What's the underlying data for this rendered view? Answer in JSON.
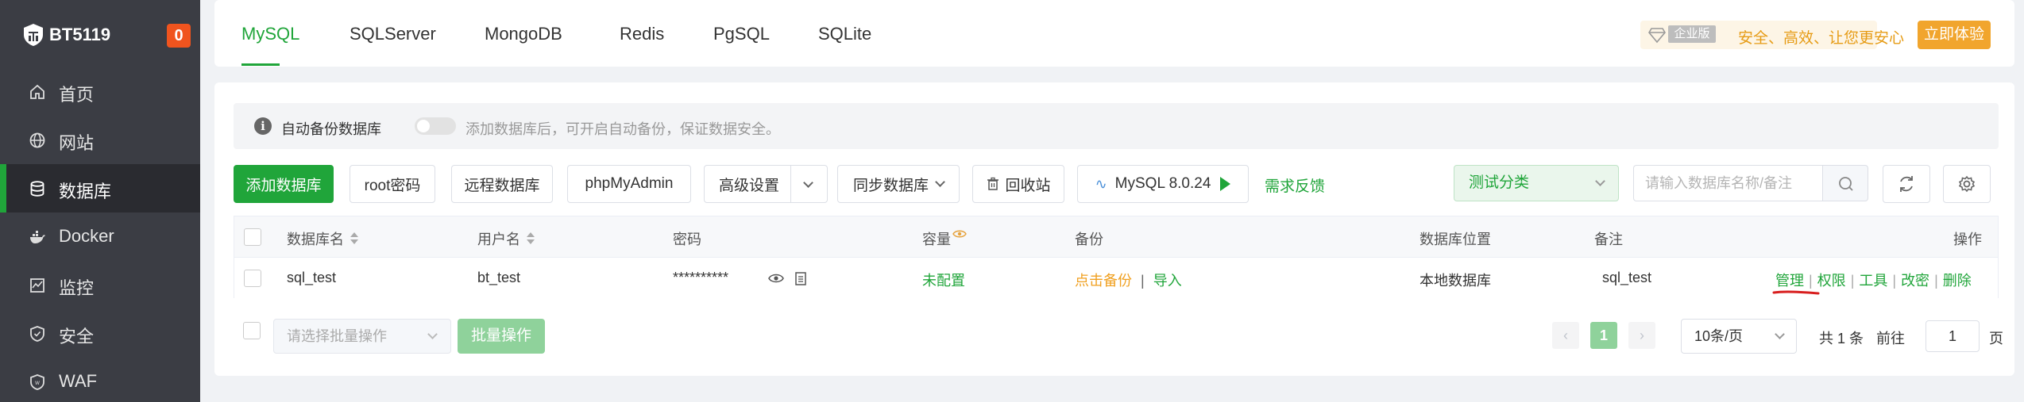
{
  "sidebar": {
    "brand": {
      "name": "BT5119",
      "badge": "0"
    },
    "items": [
      {
        "label": "首页",
        "icon": "home-icon"
      },
      {
        "label": "网站",
        "icon": "globe-icon"
      },
      {
        "label": "数据库",
        "icon": "database-icon",
        "active": true
      },
      {
        "label": "Docker",
        "icon": "docker-icon"
      },
      {
        "label": "监控",
        "icon": "monitor-icon"
      },
      {
        "label": "安全",
        "icon": "shield-icon"
      },
      {
        "label": "WAF",
        "icon": "waf-shield-icon"
      }
    ]
  },
  "tabs": {
    "items": [
      "MySQL",
      "SQLServer",
      "MongoDB",
      "Redis",
      "PgSQL",
      "SQLite"
    ],
    "active": "MySQL"
  },
  "enterprise": {
    "tag": "企业版",
    "slogan": "安全、高效、让您更安心",
    "try_label": "立即体验",
    "accent": "#f1a52d"
  },
  "notice": {
    "label": "自动备份数据库",
    "hint": "添加数据库后，可开启自动备份，保证数据安全。",
    "toggle_on": false
  },
  "toolbar": {
    "add_db": "添加数据库",
    "root_pwd": "root密码",
    "remote_db": "远程数据库",
    "phpmyadmin": "phpMyAdmin",
    "advanced": "高级设置",
    "sync": "同步数据库",
    "recycle": "回收站",
    "mysql_version": "MySQL 8.0.24",
    "feedback": "需求反馈",
    "category": "测试分类",
    "search_placeholder": "请输入数据库名称/备注"
  },
  "table": {
    "headers": {
      "name": "数据库名",
      "user": "用户名",
      "password": "密码",
      "capacity": "容量",
      "backup": "备份",
      "location": "数据库位置",
      "remark": "备注",
      "actions": "操作"
    },
    "rows": [
      {
        "name": "sql_test",
        "user": "bt_test",
        "password": "**********",
        "capacity": "未配置",
        "backup_click": "点击备份",
        "backup_sep": "|",
        "backup_import": "导入",
        "location": "本地数据库",
        "remark": "sql_test",
        "ops": [
          "管理",
          "权限",
          "工具",
          "改密",
          "删除"
        ],
        "op_sep": "|"
      }
    ]
  },
  "footer": {
    "batch_placeholder": "请选择批量操作",
    "batch_btn": "批量操作",
    "current_page": "1",
    "page_size": "10条/页",
    "total": "共 1 条",
    "goto": "前往",
    "goto_value": "1",
    "page_unit": "页"
  },
  "colors": {
    "brand_green": "#20a53a",
    "sidebar_bg": "#3b3d44",
    "badge_orange": "#f0541e"
  }
}
